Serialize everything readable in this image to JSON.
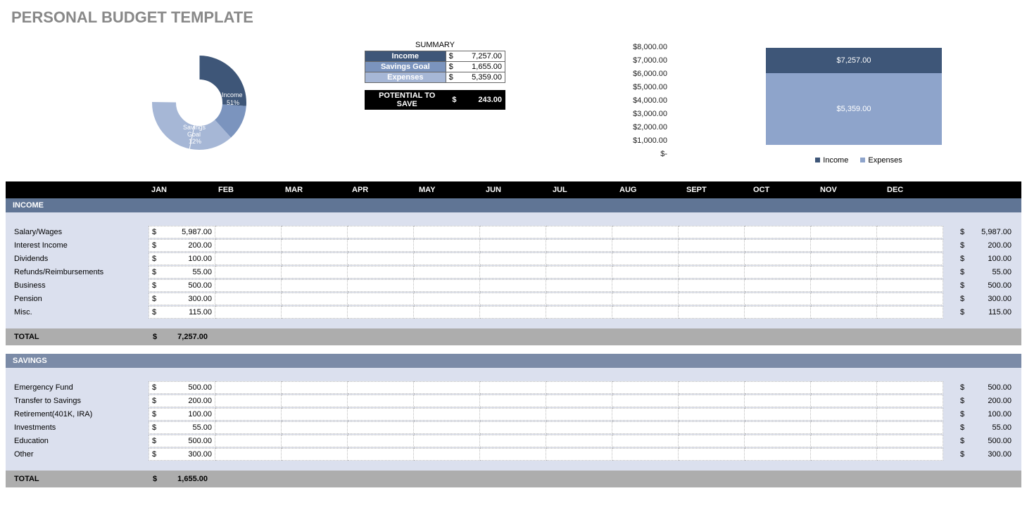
{
  "title": "PERSONAL BUDGET TEMPLATE",
  "summary": {
    "heading": "SUMMARY",
    "rows": [
      {
        "label": "Income",
        "value": "7,257.00",
        "color": "#3e5678"
      },
      {
        "label": "Savings Goal",
        "value": "1,655.00",
        "color": "#7b94be"
      },
      {
        "label": "Expenses",
        "value": "5,359.00",
        "color": "#a6b7d6"
      }
    ],
    "pts_label": "POTENTIAL TO SAVE",
    "pts_value": "243.00"
  },
  "donut": {
    "segments": [
      {
        "label": "Income",
        "pct": "51%",
        "color": "#3e5678"
      },
      {
        "label": "Savings\nGoal",
        "pct": "12%",
        "color": "#7b94be"
      },
      {
        "label": "Expenses",
        "pct": "37%",
        "color": "#a6b7d6"
      }
    ]
  },
  "axis": {
    "ticks": [
      "$8,000.00",
      "$7,000.00",
      "$6,000.00",
      "$5,000.00",
      "$4,000.00",
      "$3,000.00",
      "$2,000.00",
      "$1,000.00",
      "$-"
    ]
  },
  "bar": {
    "items": [
      {
        "label": "$7,257.00",
        "color": "#3e5678",
        "h": 36
      },
      {
        "label": "$5,359.00",
        "color": "#8ea4cb",
        "h": 102
      }
    ],
    "legend": [
      {
        "label": "Income",
        "color": "#3e5678"
      },
      {
        "label": "Expenses",
        "color": "#8ea4cb"
      }
    ]
  },
  "months": [
    "JAN",
    "FEB",
    "MAR",
    "APR",
    "MAY",
    "JUN",
    "JUL",
    "AUG",
    "SEPT",
    "OCT",
    "NOV",
    "DEC"
  ],
  "currency": "$",
  "sections": [
    {
      "title": "INCOME",
      "hdr_color": "#607595",
      "rows": [
        {
          "label": "Salary/Wages",
          "jan": "5,987.00",
          "total": "5,987.00"
        },
        {
          "label": "Interest Income",
          "jan": "200.00",
          "total": "200.00"
        },
        {
          "label": "Dividends",
          "jan": "100.00",
          "total": "100.00"
        },
        {
          "label": "Refunds/Reimbursements",
          "jan": "55.00",
          "total": "55.00"
        },
        {
          "label": "Business",
          "jan": "500.00",
          "total": "500.00"
        },
        {
          "label": "Pension",
          "jan": "300.00",
          "total": "300.00"
        },
        {
          "label": "Misc.",
          "jan": "115.00",
          "total": "115.00"
        }
      ],
      "total_label": "TOTAL",
      "total_value": "7,257.00"
    },
    {
      "title": "SAVINGS",
      "hdr_color": "#7b8ba7",
      "rows": [
        {
          "label": "Emergency Fund",
          "jan": "500.00",
          "total": "500.00"
        },
        {
          "label": "Transfer to Savings",
          "jan": "200.00",
          "total": "200.00"
        },
        {
          "label": "Retirement(401K, IRA)",
          "jan": "100.00",
          "total": "100.00"
        },
        {
          "label": "Investments",
          "jan": "55.00",
          "total": "55.00"
        },
        {
          "label": "Education",
          "jan": "500.00",
          "total": "500.00"
        },
        {
          "label": "Other",
          "jan": "300.00",
          "total": "300.00"
        }
      ],
      "total_label": "TOTAL",
      "total_value": "1,655.00"
    }
  ],
  "chart_data": [
    {
      "type": "pie",
      "title": "",
      "series": [
        {
          "name": "Income",
          "value": 51
        },
        {
          "name": "Savings Goal",
          "value": 12
        },
        {
          "name": "Expenses",
          "value": 37
        }
      ]
    },
    {
      "type": "bar",
      "categories": [
        "Income",
        "Expenses"
      ],
      "values": [
        7257,
        5359
      ],
      "ylim": [
        0,
        8000
      ],
      "ylabel": "",
      "title": ""
    }
  ]
}
